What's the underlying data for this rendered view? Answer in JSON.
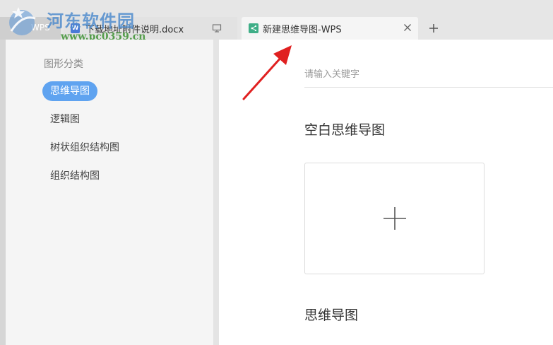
{
  "watermark": {
    "title": "河东软件园",
    "url": "www.pc0359.cn"
  },
  "tabs": {
    "home": {
      "label": "WPS"
    },
    "items": [
      {
        "label": "下载地址附件说明.docx",
        "icon": "doc-icon"
      },
      {
        "label": "新建思维导图-WPS",
        "icon": "mindmap-icon",
        "active": true
      }
    ]
  },
  "sidebar": {
    "title": "图形分类",
    "items": [
      {
        "label": "思维导图",
        "active": true
      },
      {
        "label": "逻辑图"
      },
      {
        "label": "树状组织结构图"
      },
      {
        "label": "组织结构图"
      }
    ]
  },
  "main": {
    "search_placeholder": "请输入关键字",
    "sections": [
      {
        "title": "空白思维导图"
      },
      {
        "title": "思维导图"
      }
    ]
  },
  "colors": {
    "accent": "#5fa3f0",
    "mindmap_tab_icon": "#3fae87",
    "doc_tab_icon": "#4a7ad6",
    "annotation": "#e02020"
  }
}
